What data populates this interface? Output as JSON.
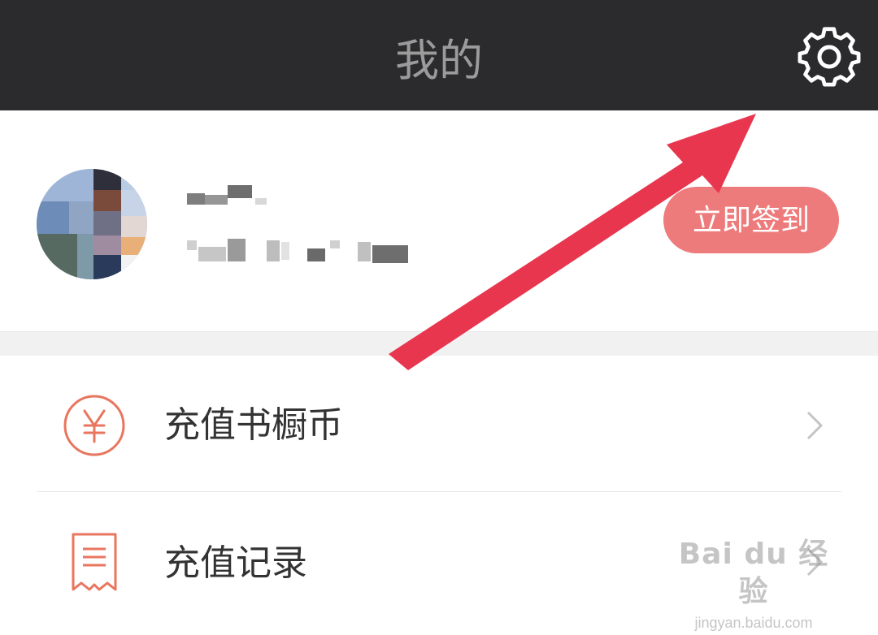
{
  "header": {
    "title": "我的",
    "settings_icon": "gear-icon"
  },
  "profile": {
    "checkin_label": "立即签到"
  },
  "menu": [
    {
      "label": "充值书橱币",
      "icon": "yen-circle-icon"
    },
    {
      "label": "充值记录",
      "icon": "receipt-icon"
    }
  ],
  "watermark": {
    "brand": "Bai du 经验",
    "url": "jingyan.baidu.com"
  },
  "colors": {
    "topbar": "#2b2b2d",
    "accent": "#ee7b7b",
    "icon": "#e8765f",
    "arrow": "#e8364f"
  }
}
